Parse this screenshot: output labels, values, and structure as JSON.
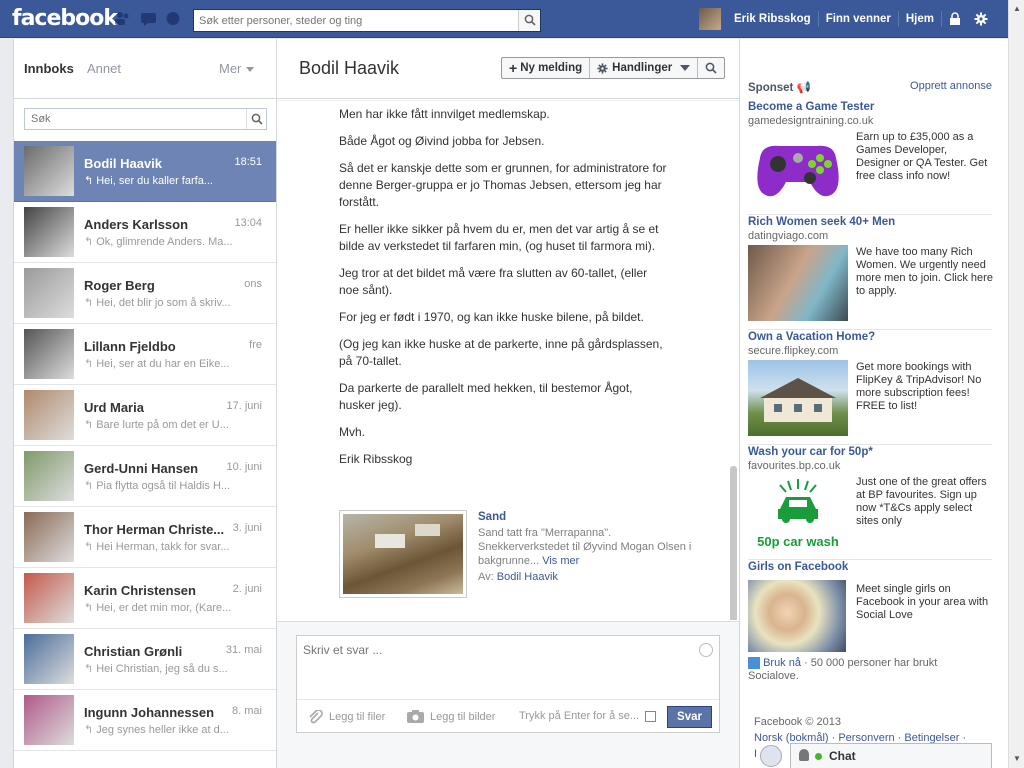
{
  "header": {
    "logo": "facebook",
    "search_placeholder": "Søk etter personer, steder og ting",
    "user_name": "Erik Ribsskog",
    "find_friends": "Finn venner",
    "home": "Hjem",
    "brand_color": "#3b5998"
  },
  "inbox": {
    "tab_inbox": "Innboks",
    "tab_other": "Annet",
    "more": "Mer",
    "search_placeholder": "Søk",
    "threads": [
      {
        "name": "Bodil Haavik",
        "time": "18:51",
        "snippet": "Hei, ser du kaller farfa...",
        "selected": true,
        "color": "#6b6b6b"
      },
      {
        "name": "Anders Karlsson",
        "time": "13:04",
        "snippet": "Ok, glimrende Anders. Ma...",
        "color": "#444"
      },
      {
        "name": "Roger Berg",
        "time": "ons",
        "snippet": "Hei, det blir jo som å skriv...",
        "color": "#9a9a9a"
      },
      {
        "name": "Lillann Fjeldbo",
        "time": "fre",
        "snippet": "Hei, ser at du har en Eike...",
        "color": "#555"
      },
      {
        "name": "Urd Maria",
        "time": "17. juni",
        "snippet": "Bare lurte på om det er U...",
        "color": "#b08a6b"
      },
      {
        "name": "Gerd-Unni Hansen",
        "time": "10. juni",
        "snippet": "Pia flytta også til Haldis H...",
        "color": "#7f9a6a"
      },
      {
        "name": "Thor Herman Christe...",
        "time": "3. juni",
        "snippet": "Hei Herman, takk for svar...",
        "color": "#8a6a55"
      },
      {
        "name": "Karin Christensen",
        "time": "2. juni",
        "snippet": "Hei, er det min mor, (Kare...",
        "color": "#c45a4a"
      },
      {
        "name": "Christian Grønli",
        "time": "31. mai",
        "snippet": "Hei Christian, jeg så du s...",
        "color": "#4a6d9a"
      },
      {
        "name": "Ingunn Johannessen",
        "time": "8. mai",
        "snippet": "Jeg synes heller ikke at d...",
        "color": "#b05a8a"
      }
    ]
  },
  "conversation": {
    "title": "Bodil Haavik",
    "new_message": "Ny melding",
    "actions": "Handlinger",
    "paragraphs": [
      "Men har ikke fått innvilget medlemskap.",
      "Både Ågot og Øivind jobba for Jebsen.",
      "Så det er kanskje dette som er grunnen, for administratore for denne Berger-gruppa er jo Thomas Jebsen, ettersom jeg har forstått.",
      "Er heller ikke sikker på hvem du er, men det var artig å se et bilde av verkstedet til farfaren min, (og huset til farmora mi).",
      "Jeg tror at det bildet må være fra slutten av 60-tallet, (eller noe sånt).",
      "For jeg er født i 1970, og kan ikke huske bilene, på bildet.",
      "(Og jeg kan ikke huske at de parkerte, inne på gårdsplassen, på 70-tallet.",
      "Da parkerte de parallelt med hekken, til bestemor Ågot, husker jeg).",
      "Mvh.",
      "Erik Ribsskog"
    ],
    "attachment": {
      "title": "Sand",
      "description": "Sand tatt fra \"Merrapanna\". Snekkerverkstedet til Øyvind Mogan Olsen i bakgrunne...",
      "see_more": "Vis mer",
      "by_label": "Av:",
      "by_name": "Bodil Haavik"
    },
    "reply_placeholder": "Skriv et svar ...",
    "add_files": "Legg til filer",
    "add_photos": "Legg til bilder",
    "enter_to_send": "Trykk på Enter for å se...",
    "send": "Svar"
  },
  "sidebar": {
    "sponsored": "Sponset",
    "create_ad": "Opprett annonse",
    "ads": [
      {
        "title": "Become a Game Tester",
        "domain": "gamedesigntraining.co.uk",
        "text": "Earn up to £35,000 as a Games Developer, Designer or QA Tester. Get free class info now!"
      },
      {
        "title": "Rich Women seek 40+ Men",
        "domain": "datingviago.com",
        "text": "We have too many Rich Women. We urgently need more men to join. Click here to apply."
      },
      {
        "title": "Own a Vacation Home?",
        "domain": "secure.flipkey.com",
        "text": "Get more bookings with FlipKey & TripAdvisor! No more subscription fees! FREE to list!"
      },
      {
        "title": "Wash your car for 50p*",
        "domain": "favourites.bp.co.uk",
        "text": "Just one of the great offers at BP favourites. Sign up now *T&Cs apply select sites only",
        "image_caption": "50p car wash"
      },
      {
        "title": "Girls on Facebook",
        "domain": "",
        "text": "Meet single girls on Facebook in your area with Social Love"
      }
    ],
    "like_link": "Bruk nå",
    "like_text": "· 50 000 personer har brukt Socialove.",
    "footer_copyright": "Facebook © 2013",
    "footer_links": "Norsk (bokmål) · Personvern · Betingelser ·",
    "footer_more": "I"
  },
  "chat": {
    "label": "Chat"
  }
}
